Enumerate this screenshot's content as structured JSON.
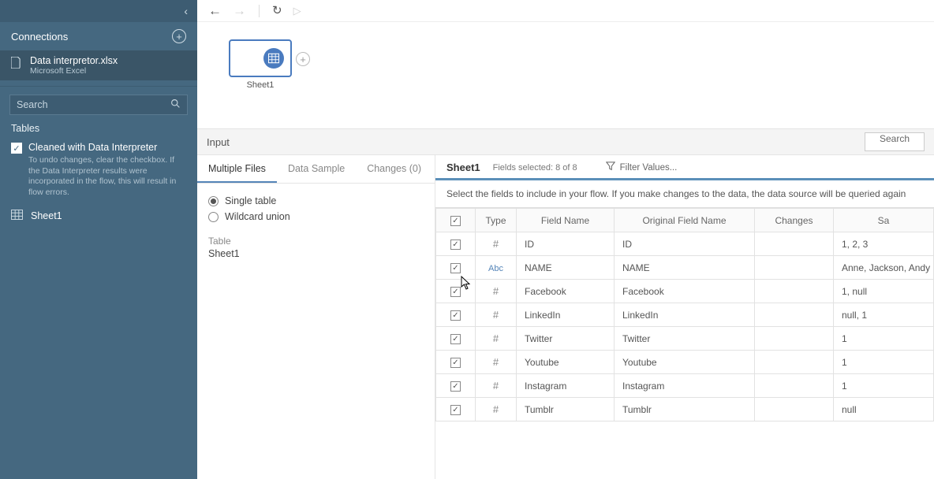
{
  "sidebar": {
    "connections_label": "Connections",
    "file_name": "Data interpretor.xlsx",
    "file_sub": "Microsoft Excel",
    "search_placeholder": "Search",
    "tables_label": "Tables",
    "cleaned_label": "Cleaned with Data Interpreter",
    "cleaned_desc": "To undo changes, clear the checkbox. If the Data Interpreter results were incorporated in the flow, this will result in flow errors.",
    "table_item": "Sheet1"
  },
  "canvas": {
    "node_label": "Sheet1"
  },
  "panel": {
    "title": "Input",
    "search_btn": "Search"
  },
  "left": {
    "tab_multiple": "Multiple Files",
    "tab_sample": "Data Sample",
    "tab_changes": "Changes (0)",
    "radio_single": "Single table",
    "radio_wildcard": "Wildcard union",
    "table_lbl": "Table",
    "table_val": "Sheet1"
  },
  "right": {
    "sheet_name": "Sheet1",
    "fields_selected": "Fields selected: 8 of 8",
    "filter_label": "Filter Values...",
    "instruction": "Select the fields to include in your flow. If you make changes to the data, the data source will be queried again",
    "headers": {
      "type": "Type",
      "field_name": "Field Name",
      "original_field_name": "Original Field Name",
      "changes": "Changes",
      "sample": "Sa"
    },
    "rows": [
      {
        "type": "hash",
        "field": "ID",
        "orig": "ID",
        "sample": "1, 2, 3"
      },
      {
        "type": "abc",
        "field": "NAME",
        "orig": "NAME",
        "sample": "Anne, Jackson, Andy"
      },
      {
        "type": "hash",
        "field": "Facebook",
        "orig": "Facebook",
        "sample": "1, null"
      },
      {
        "type": "hash",
        "field": "LinkedIn",
        "orig": "LinkedIn",
        "sample": "null, 1"
      },
      {
        "type": "hash",
        "field": "Twitter",
        "orig": "Twitter",
        "sample": "1"
      },
      {
        "type": "hash",
        "field": "Youtube",
        "orig": "Youtube",
        "sample": "1"
      },
      {
        "type": "hash",
        "field": "Instagram",
        "orig": "Instagram",
        "sample": "1"
      },
      {
        "type": "hash",
        "field": "Tumblr",
        "orig": "Tumblr",
        "sample": "null"
      }
    ]
  }
}
